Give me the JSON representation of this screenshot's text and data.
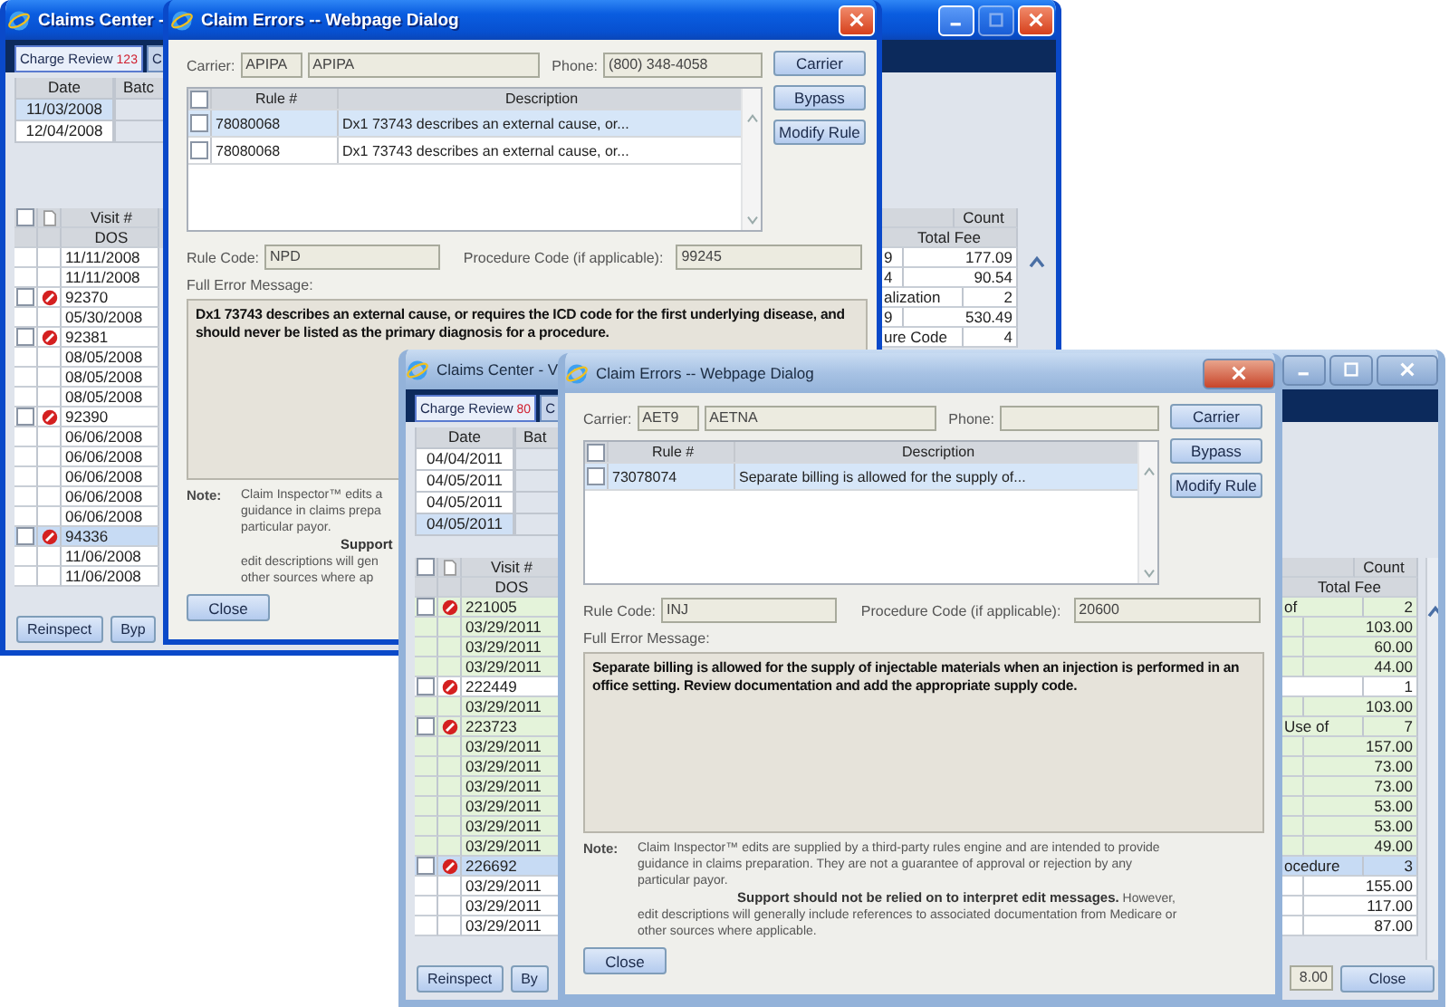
{
  "scenes": [
    {
      "main": {
        "kind": "xp",
        "title": "Claims Center -",
        "tabs": [
          {
            "label": "Charge Review",
            "count": "123",
            "selected": true
          },
          {
            "label": "C",
            "selected": false
          }
        ],
        "date_table": {
          "columns": [
            "Date",
            "Batc"
          ],
          "rows": [
            {
              "date": "11/03/2008",
              "selected": true
            },
            {
              "date": "12/04/2008",
              "selected": false
            }
          ]
        },
        "visit_table": {
          "header_checked": false,
          "columns": [
            "Visit #",
            "DOS"
          ],
          "right_columns": [
            "Count",
            "Total Fee"
          ],
          "rows": [
            {
              "kind": "line",
              "text": "11/11/2008",
              "column_a": "9",
              "column_b": "177.09",
              "selected": false
            },
            {
              "kind": "line",
              "text": "11/11/2008",
              "column_a": "4",
              "column_b": "90.54",
              "selected": false
            },
            {
              "kind": "visit",
              "text": "92370",
              "checked": false,
              "error": true,
              "column_a": "alization",
              "column_b": "2",
              "selected": false
            },
            {
              "kind": "line",
              "text": "05/30/2008",
              "column_a": "9",
              "column_b": "530.49",
              "selected": false
            },
            {
              "kind": "visit",
              "text": "92381",
              "checked": false,
              "error": true,
              "column_a": "ure Code",
              "column_b": "4",
              "selected": false
            },
            {
              "kind": "line",
              "text": "08/05/2008",
              "selected": false
            },
            {
              "kind": "line",
              "text": "08/05/2008",
              "selected": false
            },
            {
              "kind": "line",
              "text": "08/05/2008",
              "selected": false
            },
            {
              "kind": "visit",
              "text": "92390",
              "checked": false,
              "error": true,
              "selected": false
            },
            {
              "kind": "line",
              "text": "06/06/2008",
              "selected": false
            },
            {
              "kind": "line",
              "text": "06/06/2008",
              "selected": false
            },
            {
              "kind": "line",
              "text": "06/06/2008",
              "selected": false
            },
            {
              "kind": "line",
              "text": "06/06/2008",
              "selected": false
            },
            {
              "kind": "line",
              "text": "06/06/2008",
              "selected": false
            },
            {
              "kind": "visit",
              "text": "94336",
              "checked": false,
              "error": true,
              "selected": true
            },
            {
              "kind": "line",
              "text": "11/06/2008",
              "selected": false
            },
            {
              "kind": "line",
              "text": "11/06/2008",
              "selected": false
            }
          ]
        },
        "buttons": [
          "Reinspect",
          "Byp"
        ]
      },
      "dialog": {
        "kind": "xp",
        "title": "Claim Errors -- Webpage Dialog",
        "carrier_label": "Carrier:",
        "carrier_code": "APIPA",
        "carrier_name": "APIPA",
        "phone_label": "Phone:",
        "phone": "(800) 348-4058",
        "buttons": [
          "Carrier",
          "Bypass",
          "Modify Rule"
        ],
        "rule_columns": [
          "Rule #",
          "Description"
        ],
        "header_checked": false,
        "rules": [
          {
            "rule": "78080068",
            "description": "Dx1 73743 describes an external cause, or...",
            "checked": false,
            "selected": true
          },
          {
            "rule": "78080068",
            "description": "Dx1 73743 describes an external cause, or...",
            "checked": false,
            "selected": false
          }
        ],
        "rule_code_label": "Rule Code:",
        "rule_code": "NPD",
        "procedure_label": "Procedure Code (if applicable):",
        "procedure_code": "99245",
        "message_label": "Full Error Message:",
        "message": "Dx1 73743 describes an external cause, or requires the ICD code for the first underlying disease, and should never be listed as the primary diagnosis for a procedure.",
        "note_label": "Note:",
        "note_lines": [
          "Claim Inspector™ edits a",
          "guidance in claims prepa",
          "particular payor.",
          "**Support**",
          "edit descriptions will gen",
          "other sources where ap"
        ],
        "close": "Close"
      }
    },
    {
      "main": {
        "kind": "aero",
        "title": "Claims Center - V",
        "tabs": [
          {
            "label": "Charge Review",
            "count": "80",
            "selected": true
          },
          {
            "label": "C",
            "selected": false
          }
        ],
        "date_table": {
          "columns": [
            "Date",
            "Bat"
          ],
          "rows": [
            {
              "date": "04/04/2011",
              "selected": false
            },
            {
              "date": "04/05/2011",
              "selected": false
            },
            {
              "date": "04/05/2011",
              "selected": false
            },
            {
              "date": "04/05/2011",
              "selected": true
            }
          ]
        },
        "visit_table": {
          "header_checked": false,
          "columns": [
            "Visit #",
            "DOS"
          ],
          "right_columns": [
            "Count",
            "Total Fee"
          ],
          "rows": [
            {
              "kind": "visit",
              "text": "221005",
              "checked": false,
              "error": true,
              "column_a": "of",
              "column_b": "2",
              "selected": false,
              "color": "#e4f3da"
            },
            {
              "kind": "line",
              "text": "03/29/2011",
              "column_b": "103.00",
              "selected": false,
              "color": "#e4f3da"
            },
            {
              "kind": "line",
              "text": "03/29/2011",
              "column_b": "60.00",
              "selected": false,
              "color": "#e4f3da"
            },
            {
              "kind": "line",
              "text": "03/29/2011",
              "column_b": "44.00",
              "selected": false,
              "color": "#e4f3da"
            },
            {
              "kind": "visit",
              "text": "222449",
              "checked": false,
              "error": true,
              "column_b": "1",
              "selected": false
            },
            {
              "kind": "line",
              "text": "03/29/2011",
              "column_b": "103.00",
              "selected": false,
              "color": "#e4f3da"
            },
            {
              "kind": "visit",
              "text": "223723",
              "checked": false,
              "error": true,
              "column_a": "Use of",
              "column_b": "7",
              "selected": false,
              "color": "#e4f3da"
            },
            {
              "kind": "line",
              "text": "03/29/2011",
              "column_b": "157.00",
              "selected": false,
              "color": "#e4f3da"
            },
            {
              "kind": "line",
              "text": "03/29/2011",
              "column_b": "73.00",
              "selected": false,
              "color": "#e4f3da"
            },
            {
              "kind": "line",
              "text": "03/29/2011",
              "column_b": "73.00",
              "selected": false,
              "color": "#e4f3da"
            },
            {
              "kind": "line",
              "text": "03/29/2011",
              "column_b": "53.00",
              "selected": false,
              "color": "#e4f3da"
            },
            {
              "kind": "line",
              "text": "03/29/2011",
              "column_b": "53.00",
              "selected": false,
              "color": "#e4f3da"
            },
            {
              "kind": "line",
              "text": "03/29/2011",
              "column_b": "49.00",
              "selected": false,
              "color": "#e4f3da"
            },
            {
              "kind": "visit",
              "text": "226692",
              "checked": false,
              "error": true,
              "column_a": "ocedure",
              "column_b": "3",
              "selected": true
            },
            {
              "kind": "line",
              "text": "03/29/2011",
              "column_b": "155.00",
              "selected": false
            },
            {
              "kind": "line",
              "text": "03/29/2011",
              "column_b": "117.00",
              "selected": false
            },
            {
              "kind": "line",
              "text": "03/29/2011",
              "column_b": "87.00",
              "selected": false
            }
          ]
        },
        "buttons": [
          "Reinspect",
          "By"
        ],
        "total_field": "8.00",
        "close": "Close"
      },
      "dialog": {
        "kind": "aero",
        "title": "Claim Errors -- Webpage Dialog",
        "carrier_label": "Carrier:",
        "carrier_code": "AET9",
        "carrier_name": "AETNA",
        "phone_label": "Phone:",
        "buttons": [
          "Carrier",
          "Bypass",
          "Modify Rule"
        ],
        "rule_columns": [
          "Rule #",
          "Description"
        ],
        "header_checked": false,
        "rules": [
          {
            "rule": "73078074",
            "description": "Separate billing is allowed for the supply of...",
            "checked": false,
            "selected": true
          }
        ],
        "rule_code_label": "Rule Code:",
        "rule_code": "INJ",
        "procedure_label": "Procedure Code (if applicable):",
        "procedure_code": "20600",
        "message_label": "Full Error Message:",
        "message": "Separate billing is allowed for the supply of injectable materials when an injection is performed in an office setting. Review documentation and add the appropriate supply code.",
        "note_label": "Note:",
        "note_lines": [
          "Claim Inspector™ edits are supplied by a third-party rules engine and are intended to provide",
          "guidance in claims preparation. They are not a guarantee of approval or rejection by any",
          "particular payor.",
          "**Support should not be relied on to interpret edit messages.** However,",
          "edit descriptions will generally include references to associated documentation from Medicare or",
          "other sources where applicable."
        ],
        "close": "Close"
      }
    }
  ]
}
